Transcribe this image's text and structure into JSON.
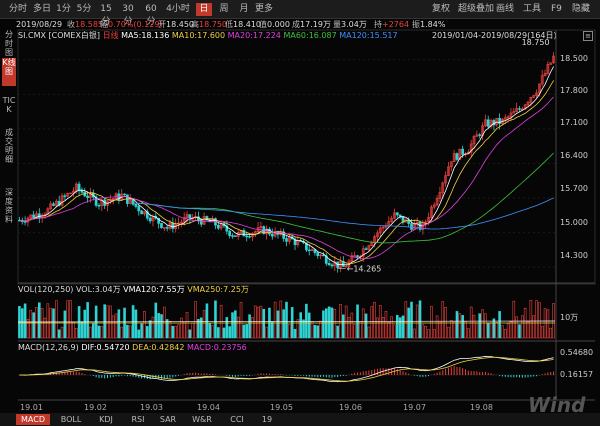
{
  "periods": [
    "分时",
    "多日",
    "1分",
    "5分",
    "15分",
    "30分",
    "60分",
    "4小时",
    "日",
    "周",
    "月",
    "更多"
  ],
  "active_period": "日",
  "toolbar": {
    "fuquan": "复权",
    "overlay": "超级叠加",
    "draw": "画线",
    "tools": "工具",
    "f9": "F9",
    "hide": "隐藏"
  },
  "side_tabs": [
    "分时图",
    "K线图",
    "TICK",
    "成交明细",
    "深度资料"
  ],
  "active_side_tab": "K线图",
  "quote": {
    "date": "2019/08/29",
    "close_label": "收",
    "close": "18.585",
    "change_label": "幅",
    "change": "0.70%(0.129)",
    "open_label": "开",
    "open": "18.450",
    "high_label": "高",
    "high": "18.750",
    "low_label": "低",
    "low": "18.410",
    "vol_label": "值",
    "vol_value": "0.000",
    "amount_label": "成",
    "amount": "17.19万",
    "qty_label": "量",
    "qty": "3.04万",
    "diff_label": "持",
    "diff": "+2764",
    "pct_label": "振",
    "pct": "1.84%"
  },
  "main_legend": {
    "symbol": "SI.CMX [COMEX白银]",
    "freq": "日线",
    "ma5": "MA5:18.136",
    "ma10": "MA10:17.600",
    "ma20": "MA20:17.224",
    "ma60": "MA60:16.087",
    "ma120": "MA120:15.517",
    "range": "2019/01/04-2019/08/29(164日)"
  },
  "vol_legend": {
    "name": "VOL(120,250)",
    "vol": "VOL:3.04万",
    "vma120": "VMA120:7.55万",
    "vma250": "VMA250:7.25万"
  },
  "macd_legend": {
    "name": "MACD(12,26,9)",
    "dif": "DIF:0.54720",
    "dea": "DEA:0.42842",
    "macd": "MACD:0.23756"
  },
  "y_labels_main": [
    "18.500",
    "17.800",
    "17.100",
    "16.400",
    "15.700",
    "15.000",
    "14.300"
  ],
  "y_labels_vol": [
    "10万"
  ],
  "y_labels_macd": [
    "0.54680",
    "0.16157"
  ],
  "high_marker": "18.750",
  "low_marker": "14.265",
  "x_labels": [
    "19.01",
    "19.02",
    "19.03",
    "19.04",
    "19.05",
    "19.06",
    "19.07",
    "19.08"
  ],
  "indicator_tabs": [
    "MACD",
    "BOLL",
    "KDJ",
    "RSI",
    "SAR",
    "W&R",
    "CCI",
    "19"
  ],
  "active_indicator": "MACD",
  "watermark": "Wind",
  "colors": {
    "up": "#e8413c",
    "down": "#2fd3d3",
    "ma5": "#ffffff",
    "ma10": "#f0d040",
    "ma20": "#e040e0",
    "ma60": "#40c040",
    "ma120": "#4090ff",
    "accent": "#c0392b"
  }
}
